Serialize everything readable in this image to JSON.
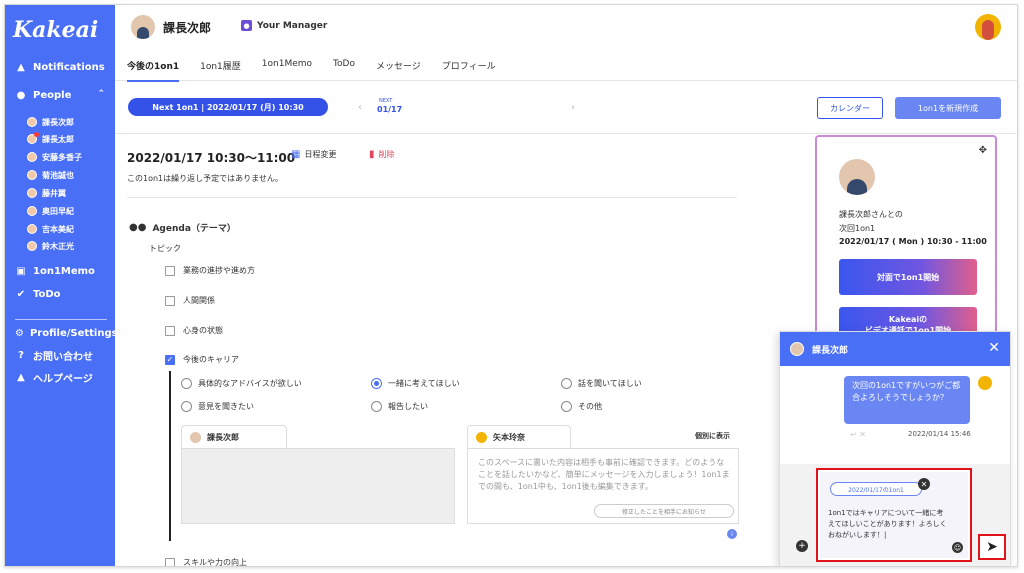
{
  "sidebar": {
    "logo": "Kakeai",
    "notifications": "Notifications",
    "people": "People",
    "people_list": [
      "課長次郎",
      "課長太郎",
      "安藤多香子",
      "菊池誠也",
      "藤井翼",
      "奥田早紀",
      "吉本美紀",
      "鈴木正光"
    ],
    "memo": "1on1Memo",
    "todo": "ToDo",
    "profile_settings": "Profile/Settings",
    "contact": "お問い合わせ",
    "help": "ヘルプページ"
  },
  "header": {
    "name": "課長次郎",
    "manager_label": "Your Manager",
    "tabs": [
      "今後の1on1",
      "1on1履歴",
      "1on1Memo",
      "ToDo",
      "メッセージ",
      "プロフィール"
    ]
  },
  "datebar": {
    "next_pill": "Next 1on1  |  2022/01/17 (月) 10:30",
    "next_mini": "NEXT",
    "next_date": "01/17",
    "calendar_btn": "カレンダー",
    "new_btn": "1on1を新規作成"
  },
  "main": {
    "datetime": "2022/01/17   10:30〜11:00",
    "reschedule": "日程変更",
    "delete": "削除",
    "repeat_note": "この1on1は繰り返し予定ではありません。",
    "agenda_title": "Agenda（テーマ）",
    "topic_label": "トピック",
    "topics": [
      "業務の進捗や進め方",
      "人間関係",
      "心身の状態",
      "今後のキャリア",
      "スキルや力の向上"
    ],
    "radios": [
      "具体的なアドバイスが欲しい",
      "一緒に考えてほしい",
      "話を聞いてほしい",
      "意見を聞きたい",
      "報告したい",
      "その他"
    ],
    "tab_a_name": "課長次郎",
    "tab_b_name": "矢本玲奈",
    "individual_label": "個別に表示",
    "box_b_text": "このスペースに書いた内容は相手も事前に確認できます。どのようなことを話したいかなど、簡単にメッセージを入力しましょう！1on1までの間も、1on1中も、1on1後も編集できます。",
    "notify_btn": "修正したことを相手にお知らせ"
  },
  "card": {
    "line1": "課長次郎さんとの",
    "line2": "次回1on1",
    "line3": "2022/01/17 ( Mon ) 10:30 - 11:00",
    "btn1": "対面で1on1開始",
    "btn2_l1": "Kakeaiの",
    "btn2_l2": "ビデオ通話で1on1開始"
  },
  "chat": {
    "title": "課長次郎",
    "message": "次回の1on1ですがいつがご都合よろしそうでしょうか？",
    "time": "2022/01/14 15:46",
    "context_tag": "2022/01/17の1on1",
    "compose_text": "1on1ではキャリアについて一緒に考えてほしいことがあります！よろしくおねがいします！|"
  }
}
